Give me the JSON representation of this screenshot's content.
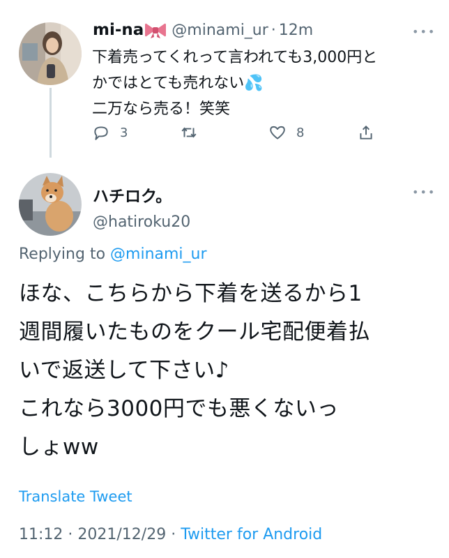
{
  "tweet1": {
    "display_name": "mi-na",
    "handle": "@minami_ur",
    "separator": "·",
    "time": "12m",
    "lines": [
      "下着売ってくれって言われても3,000円と",
      "かではとても売れない💦",
      "二万なら売る！笑笑"
    ],
    "actions": {
      "reply_count": "3",
      "retweet_count": "",
      "like_count": "8"
    },
    "more_label": "•••"
  },
  "tweet2": {
    "display_name": "ハチロク。",
    "handle": "@hatiroku20",
    "more_label": "•••",
    "replying_prefix": "Replying to",
    "replying_handle": "@minami_ur",
    "lines": [
      "ほな、こちらから下着を送るから1",
      "週間履いたものをクール宅配便着払",
      "いで返送して下さい♪",
      "これなら3000円でも悪くないっ",
      "しょww"
    ],
    "translate_label": "Translate Tweet",
    "time": "11:12",
    "date": "2021/12/29",
    "separator": "·",
    "source": "Twitter for Android"
  },
  "colors": {
    "accent": "#1d9bf0",
    "secondary_text": "#536471",
    "primary_text": "#0f1419",
    "bow": "#e8748f"
  }
}
